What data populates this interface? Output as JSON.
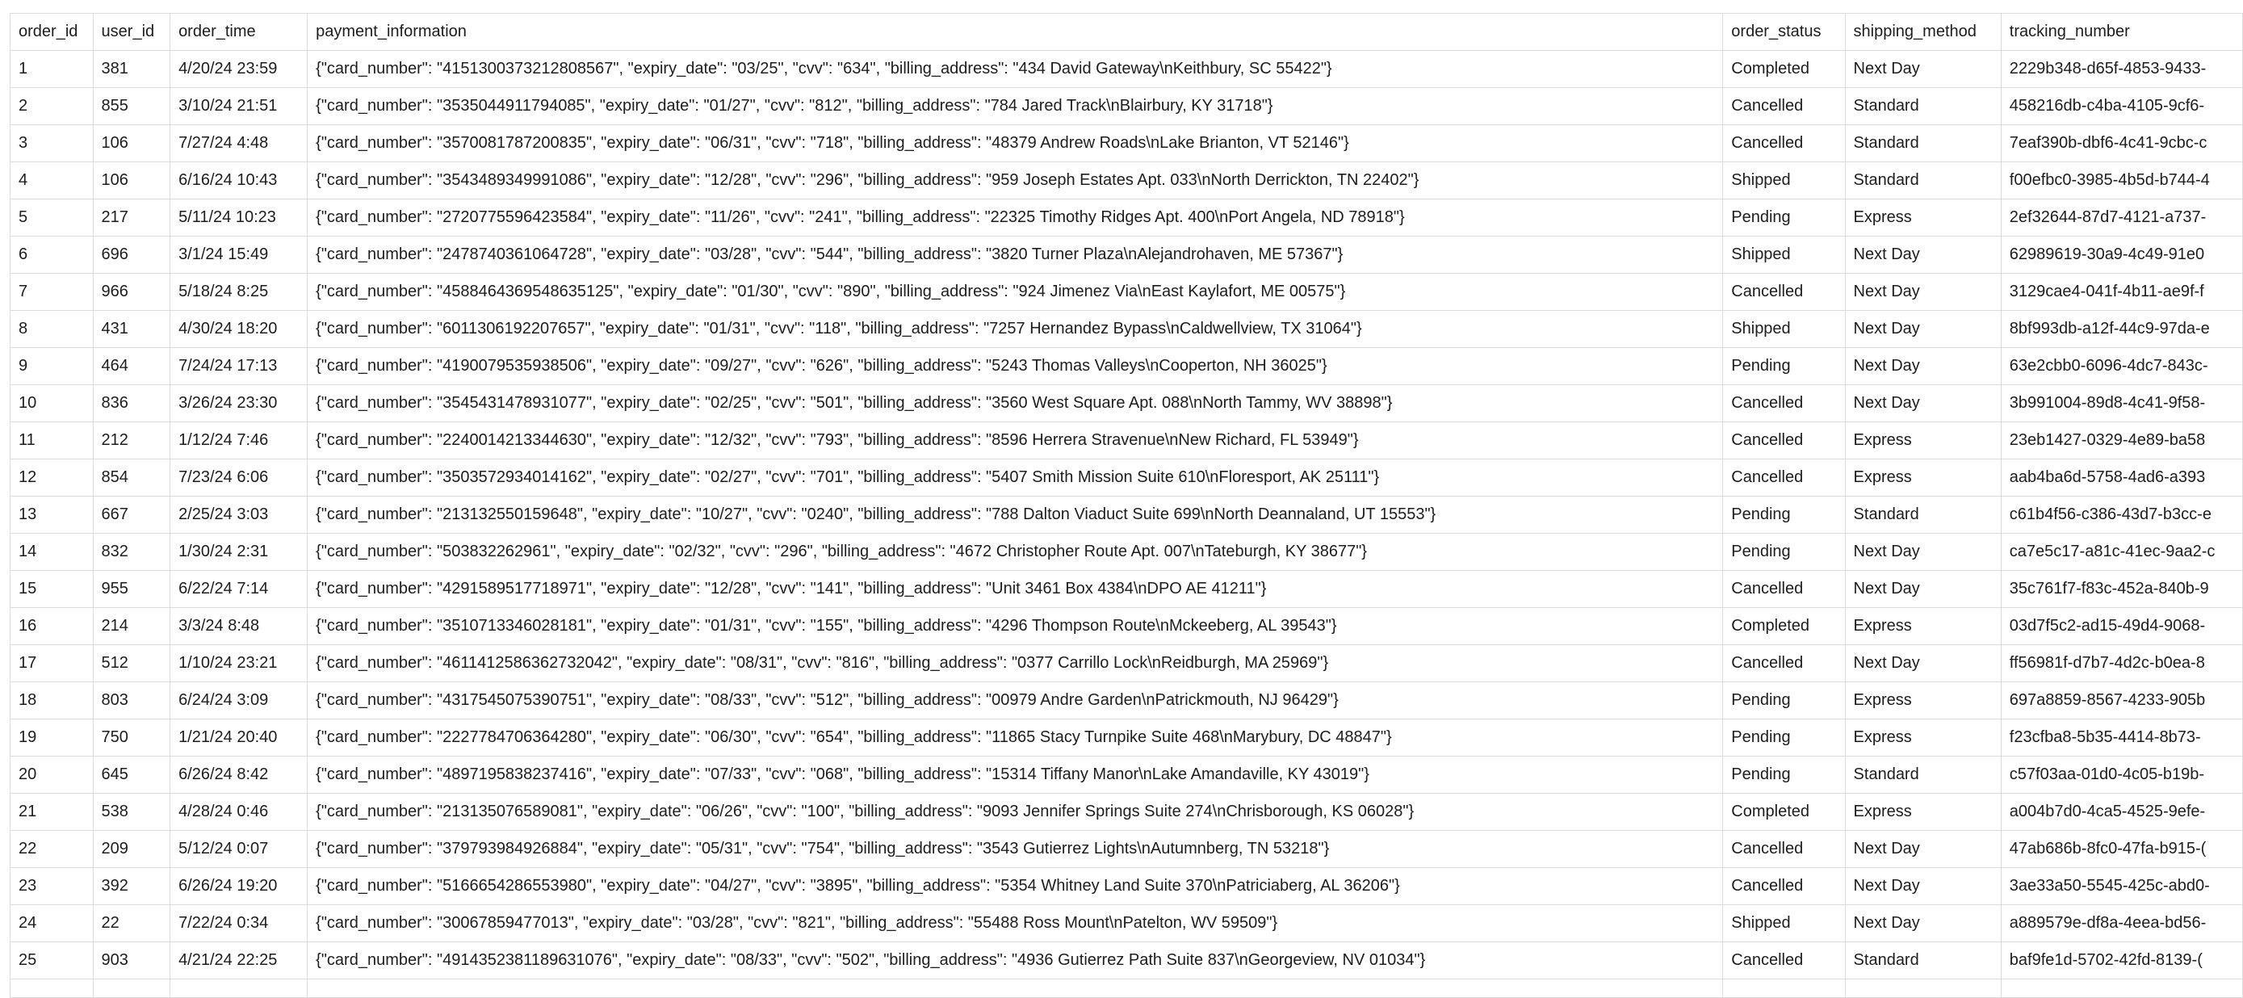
{
  "table": {
    "columns": [
      "order_id",
      "user_id",
      "order_time",
      "payment_information",
      "order_status",
      "shipping_method",
      "tracking_number"
    ],
    "rows": [
      [
        "1",
        "381",
        "4/20/24 23:59",
        "{\"card_number\": \"4151300373212808567\", \"expiry_date\": \"03/25\", \"cvv\": \"634\", \"billing_address\": \"434 David Gateway\\nKeithbury, SC 55422\"}",
        "Completed",
        "Next Day",
        "2229b348-d65f-4853-9433-"
      ],
      [
        "2",
        "855",
        "3/10/24 21:51",
        "{\"card_number\": \"3535044911794085\", \"expiry_date\": \"01/27\", \"cvv\": \"812\", \"billing_address\": \"784 Jared Track\\nBlairbury, KY 31718\"}",
        "Cancelled",
        "Standard",
        "458216db-c4ba-4105-9cf6-"
      ],
      [
        "3",
        "106",
        "7/27/24 4:48",
        "{\"card_number\": \"3570081787200835\", \"expiry_date\": \"06/31\", \"cvv\": \"718\", \"billing_address\": \"48379 Andrew Roads\\nLake Brianton, VT 52146\"}",
        "Cancelled",
        "Standard",
        "7eaf390b-dbf6-4c41-9cbc-c"
      ],
      [
        "4",
        "106",
        "6/16/24 10:43",
        "{\"card_number\": \"3543489349991086\", \"expiry_date\": \"12/28\", \"cvv\": \"296\", \"billing_address\": \"959 Joseph Estates Apt. 033\\nNorth Derrickton, TN 22402\"}",
        "Shipped",
        "Standard",
        "f00efbc0-3985-4b5d-b744-4"
      ],
      [
        "5",
        "217",
        "5/11/24 10:23",
        "{\"card_number\": \"2720775596423584\", \"expiry_date\": \"11/26\", \"cvv\": \"241\", \"billing_address\": \"22325 Timothy Ridges Apt. 400\\nPort Angela, ND 78918\"}",
        "Pending",
        "Express",
        "2ef32644-87d7-4121-a737-"
      ],
      [
        "6",
        "696",
        "3/1/24 15:49",
        "{\"card_number\": \"2478740361064728\", \"expiry_date\": \"03/28\", \"cvv\": \"544\", \"billing_address\": \"3820 Turner Plaza\\nAlejandrohaven, ME 57367\"}",
        "Shipped",
        "Next Day",
        "62989619-30a9-4c49-91e0"
      ],
      [
        "7",
        "966",
        "5/18/24 8:25",
        "{\"card_number\": \"4588464369548635125\", \"expiry_date\": \"01/30\", \"cvv\": \"890\", \"billing_address\": \"924 Jimenez Via\\nEast Kaylafort, ME 00575\"}",
        "Cancelled",
        "Next Day",
        "3129cae4-041f-4b11-ae9f-f"
      ],
      [
        "8",
        "431",
        "4/30/24 18:20",
        "{\"card_number\": \"6011306192207657\", \"expiry_date\": \"01/31\", \"cvv\": \"118\", \"billing_address\": \"7257 Hernandez Bypass\\nCaldwellview, TX 31064\"}",
        "Shipped",
        "Next Day",
        "8bf993db-a12f-44c9-97da-e"
      ],
      [
        "9",
        "464",
        "7/24/24 17:13",
        "{\"card_number\": \"4190079535938506\", \"expiry_date\": \"09/27\", \"cvv\": \"626\", \"billing_address\": \"5243 Thomas Valleys\\nCooperton, NH 36025\"}",
        "Pending",
        "Next Day",
        "63e2cbb0-6096-4dc7-843c-"
      ],
      [
        "10",
        "836",
        "3/26/24 23:30",
        "{\"card_number\": \"3545431478931077\", \"expiry_date\": \"02/25\", \"cvv\": \"501\", \"billing_address\": \"3560 West Square Apt. 088\\nNorth Tammy, WV 38898\"}",
        "Cancelled",
        "Next Day",
        "3b991004-89d8-4c41-9f58-"
      ],
      [
        "11",
        "212",
        "1/12/24 7:46",
        "{\"card_number\": \"2240014213344630\", \"expiry_date\": \"12/32\", \"cvv\": \"793\", \"billing_address\": \"8596 Herrera Stravenue\\nNew Richard, FL 53949\"}",
        "Cancelled",
        "Express",
        "23eb1427-0329-4e89-ba58"
      ],
      [
        "12",
        "854",
        "7/23/24 6:06",
        "{\"card_number\": \"3503572934014162\", \"expiry_date\": \"02/27\", \"cvv\": \"701\", \"billing_address\": \"5407 Smith Mission Suite 610\\nFloresport, AK 25111\"}",
        "Cancelled",
        "Express",
        "aab4ba6d-5758-4ad6-a393"
      ],
      [
        "13",
        "667",
        "2/25/24 3:03",
        "{\"card_number\": \"213132550159648\", \"expiry_date\": \"10/27\", \"cvv\": \"0240\", \"billing_address\": \"788 Dalton Viaduct Suite 699\\nNorth Deannaland, UT 15553\"}",
        "Pending",
        "Standard",
        "c61b4f56-c386-43d7-b3cc-e"
      ],
      [
        "14",
        "832",
        "1/30/24 2:31",
        "{\"card_number\": \"503832262961\", \"expiry_date\": \"02/32\", \"cvv\": \"296\", \"billing_address\": \"4672 Christopher Route Apt. 007\\nTateburgh, KY 38677\"}",
        "Pending",
        "Next Day",
        "ca7e5c17-a81c-41ec-9aa2-c"
      ],
      [
        "15",
        "955",
        "6/22/24 7:14",
        "{\"card_number\": \"4291589517718971\", \"expiry_date\": \"12/28\", \"cvv\": \"141\", \"billing_address\": \"Unit 3461 Box 4384\\nDPO AE 41211\"}",
        "Cancelled",
        "Next Day",
        "35c761f7-f83c-452a-840b-9"
      ],
      [
        "16",
        "214",
        "3/3/24 8:48",
        "{\"card_number\": \"3510713346028181\", \"expiry_date\": \"01/31\", \"cvv\": \"155\", \"billing_address\": \"4296 Thompson Route\\nMckeeberg, AL 39543\"}",
        "Completed",
        "Express",
        "03d7f5c2-ad15-49d4-9068-"
      ],
      [
        "17",
        "512",
        "1/10/24 23:21",
        "{\"card_number\": \"4611412586362732042\", \"expiry_date\": \"08/31\", \"cvv\": \"816\", \"billing_address\": \"0377 Carrillo Lock\\nReidburgh, MA 25969\"}",
        "Cancelled",
        "Next Day",
        "ff56981f-d7b7-4d2c-b0ea-8"
      ],
      [
        "18",
        "803",
        "6/24/24 3:09",
        "{\"card_number\": \"4317545075390751\", \"expiry_date\": \"08/33\", \"cvv\": \"512\", \"billing_address\": \"00979 Andre Garden\\nPatrickmouth, NJ 96429\"}",
        "Pending",
        "Express",
        "697a8859-8567-4233-905b"
      ],
      [
        "19",
        "750",
        "1/21/24 20:40",
        "{\"card_number\": \"2227784706364280\", \"expiry_date\": \"06/30\", \"cvv\": \"654\", \"billing_address\": \"11865 Stacy Turnpike Suite 468\\nMarybury, DC 48847\"}",
        "Pending",
        "Express",
        "f23cfba8-5b35-4414-8b73-"
      ],
      [
        "20",
        "645",
        "6/26/24 8:42",
        "{\"card_number\": \"4897195838237416\", \"expiry_date\": \"07/33\", \"cvv\": \"068\", \"billing_address\": \"15314 Tiffany Manor\\nLake Amandaville, KY 43019\"}",
        "Pending",
        "Standard",
        "c57f03aa-01d0-4c05-b19b-"
      ],
      [
        "21",
        "538",
        "4/28/24 0:46",
        "{\"card_number\": \"213135076589081\", \"expiry_date\": \"06/26\", \"cvv\": \"100\", \"billing_address\": \"9093 Jennifer Springs Suite 274\\nChrisborough, KS 06028\"}",
        "Completed",
        "Express",
        "a004b7d0-4ca5-4525-9efe-"
      ],
      [
        "22",
        "209",
        "5/12/24 0:07",
        "{\"card_number\": \"379793984926884\", \"expiry_date\": \"05/31\", \"cvv\": \"754\", \"billing_address\": \"3543 Gutierrez Lights\\nAutumnberg, TN 53218\"}",
        "Cancelled",
        "Next Day",
        "47ab686b-8fc0-47fa-b915-("
      ],
      [
        "23",
        "392",
        "6/26/24 19:20",
        "{\"card_number\": \"5166654286553980\", \"expiry_date\": \"04/27\", \"cvv\": \"3895\", \"billing_address\": \"5354 Whitney Land Suite 370\\nPatriciaberg, AL 36206\"}",
        "Cancelled",
        "Next Day",
        "3ae33a50-5545-425c-abd0-"
      ],
      [
        "24",
        "22",
        "7/22/24 0:34",
        "{\"card_number\": \"30067859477013\", \"expiry_date\": \"03/28\", \"cvv\": \"821\", \"billing_address\": \"55488 Ross Mount\\nPatelton, WV 59509\"}",
        "Shipped",
        "Next Day",
        "a889579e-df8a-4eea-bd56-"
      ],
      [
        "25",
        "903",
        "4/21/24 22:25",
        "{\"card_number\": \"4914352381189631076\", \"expiry_date\": \"08/33\", \"cvv\": \"502\", \"billing_address\": \"4936 Gutierrez Path Suite 837\\nGeorgeview, NV 01034\"}",
        "Cancelled",
        "Standard",
        "baf9fe1d-5702-42fd-8139-("
      ]
    ]
  }
}
